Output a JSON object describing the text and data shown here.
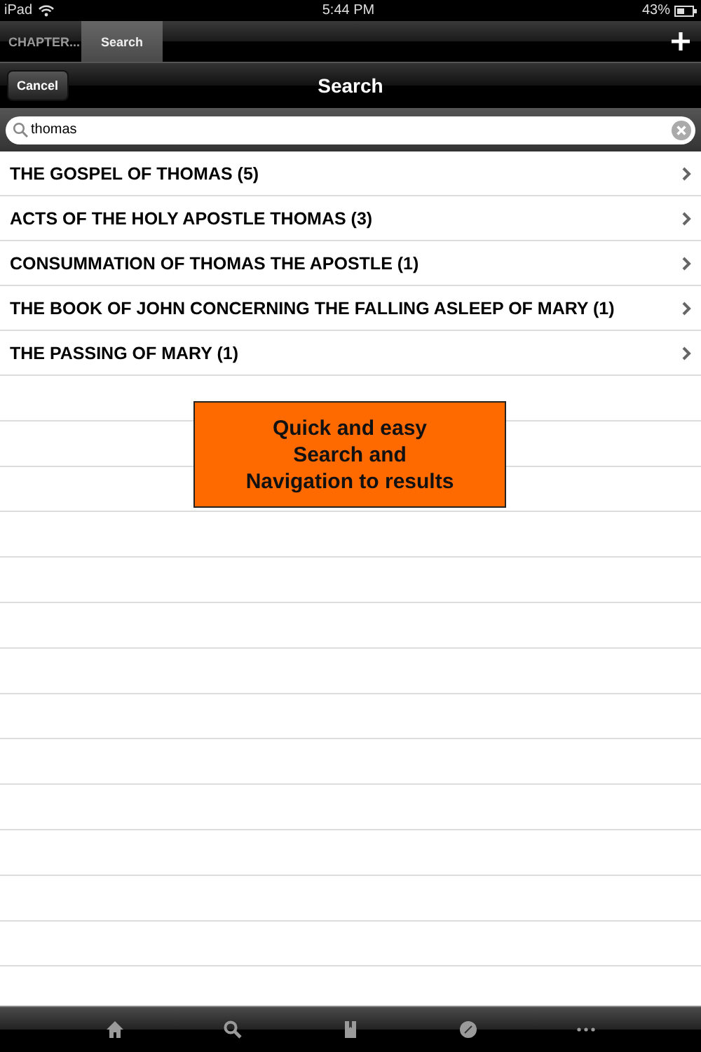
{
  "status_bar": {
    "device": "iPad",
    "time": "5:44 PM",
    "battery": "43%"
  },
  "tabs": [
    {
      "label": "CHAPTER...",
      "selected": false
    },
    {
      "label": "Search",
      "selected": true
    }
  ],
  "nav_bar": {
    "cancel": "Cancel",
    "title": "Search"
  },
  "search": {
    "value": "thomas"
  },
  "results": [
    {
      "label": "THE GOSPEL OF THOMAS (5)"
    },
    {
      "label": "ACTS OF THE HOLY APOSTLE THOMAS (3)"
    },
    {
      "label": "CONSUMMATION OF THOMAS THE APOSTLE (1)"
    },
    {
      "label": "THE BOOK OF JOHN CONCERNING THE FALLING ASLEEP OF MARY (1)"
    },
    {
      "label": "THE PASSING OF MARY (1)"
    }
  ],
  "banner": {
    "lines": [
      "Quick and easy",
      "Search and",
      "Navigation to results"
    ]
  },
  "toolbar": [
    {
      "kind": "home"
    },
    {
      "kind": "search"
    },
    {
      "kind": "book"
    },
    {
      "kind": "compass"
    },
    {
      "kind": "more"
    }
  ]
}
